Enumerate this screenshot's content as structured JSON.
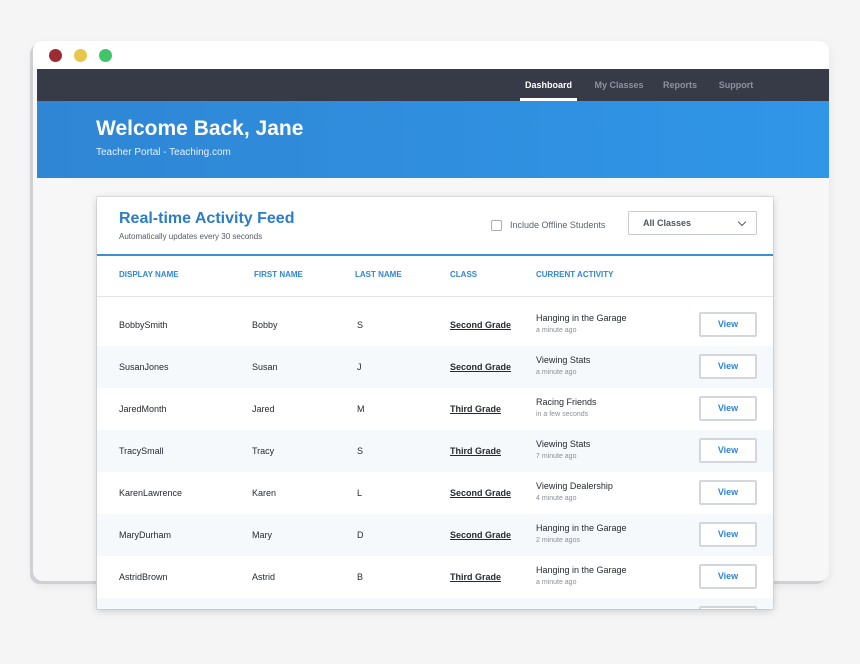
{
  "nav": {
    "items": [
      {
        "label": "Dashboard",
        "active": true
      },
      {
        "label": "My Classes",
        "active": false
      },
      {
        "label": "Reports",
        "active": false
      },
      {
        "label": "Support",
        "active": false
      }
    ]
  },
  "hero": {
    "title": "Welcome Back, Jane",
    "subtitle": "Teacher Portal - Teaching.com"
  },
  "feed": {
    "title": "Real-time Activity Feed",
    "subtitle": "Automatically updates every 30 seconds",
    "offline_label": "Include Offline Students",
    "offline_checked": false,
    "class_filter": "All Classes",
    "columns": [
      "DISPLAY NAME",
      "FIRST NAME",
      "LAST NAME",
      "CLASS",
      "CURRENT ACTIVITY"
    ],
    "view_label": "View",
    "rows": [
      {
        "display": "BobbySmith",
        "first": "Bobby",
        "last": "S",
        "class": "Second Grade",
        "activity": "Hanging in the Garage",
        "time": "a minute ago"
      },
      {
        "display": "SusanJones",
        "first": "Susan",
        "last": "J",
        "class": "Second Grade",
        "activity": "Viewing Stats",
        "time": "a minute ago"
      },
      {
        "display": "JaredMonth",
        "first": "Jared",
        "last": "M",
        "class": "Third Grade",
        "activity": "Racing Friends",
        "time": "in a few seconds"
      },
      {
        "display": "TracySmall",
        "first": "Tracy",
        "last": "S",
        "class": "Third Grade",
        "activity": "Viewing Stats",
        "time": "7 minute ago"
      },
      {
        "display": "KarenLawrence",
        "first": "Karen",
        "last": "L",
        "class": "Second Grade",
        "activity": "Viewing Dealership",
        "time": "4 minute ago"
      },
      {
        "display": "MaryDurham",
        "first": "Mary",
        "last": "D",
        "class": "Second Grade",
        "activity": "Hanging in the Garage",
        "time": "2 minute agos"
      },
      {
        "display": "AstridBrown",
        "first": "Astrid",
        "last": "B",
        "class": "Third Grade",
        "activity": "Hanging in the Garage",
        "time": "a minute ago"
      }
    ]
  },
  "colors": {
    "accent": "#2f86d4",
    "navbar": "#373a47",
    "close_dot": "#9b2b34",
    "minimize_dot": "#e8c64a",
    "maximize_dot": "#41c46a"
  }
}
